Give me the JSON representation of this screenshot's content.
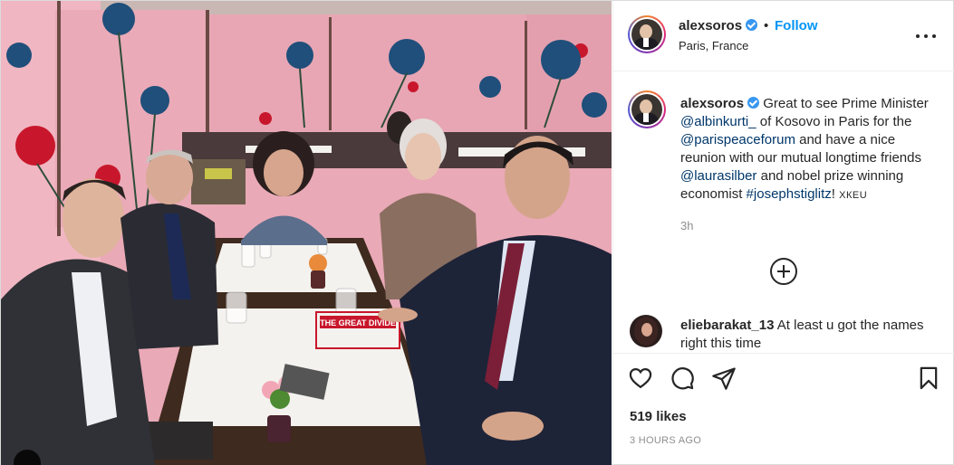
{
  "post": {
    "username": "alexsoros",
    "separator": "•",
    "follow_label": "Follow",
    "location": "Paris, France",
    "more_icon": "more-options-icon"
  },
  "caption": {
    "username": "alexsoros",
    "text_1": "Great to see Prime Minister ",
    "mention_1": "@albinkurti_",
    "text_2": " of Kosovo in Paris for the ",
    "mention_2": "@parispeaceforum",
    "text_3": " and have a nice reunion with our mutual longtime friends ",
    "mention_3": "@laurasilber",
    "text_4": " and nobel prize winning economist ",
    "hashtag": "#josephstiglitz",
    "text_5": "! ",
    "lang_tag": "ХКЕU",
    "time": "3h"
  },
  "load_more_icon": "plus-circle-icon",
  "comment": {
    "username": "eliebarakat_13",
    "text": "At least u got the names right this time"
  },
  "actions": {
    "like_icon": "heart-icon",
    "comment_icon": "comment-bubble-icon",
    "share_icon": "paper-plane-icon",
    "save_icon": "bookmark-icon"
  },
  "likes": "519 likes",
  "posted_ago": "3 HOURS AGO",
  "photo": {
    "book_title": "THE GREAT DIVIDE",
    "colors": {
      "wall": "#e9a9b6",
      "flower_red": "#c8172c",
      "flower_blue": "#1f4f7a",
      "tablecloth": "#f4f2ee",
      "table_wood": "#3e2a1e"
    }
  }
}
